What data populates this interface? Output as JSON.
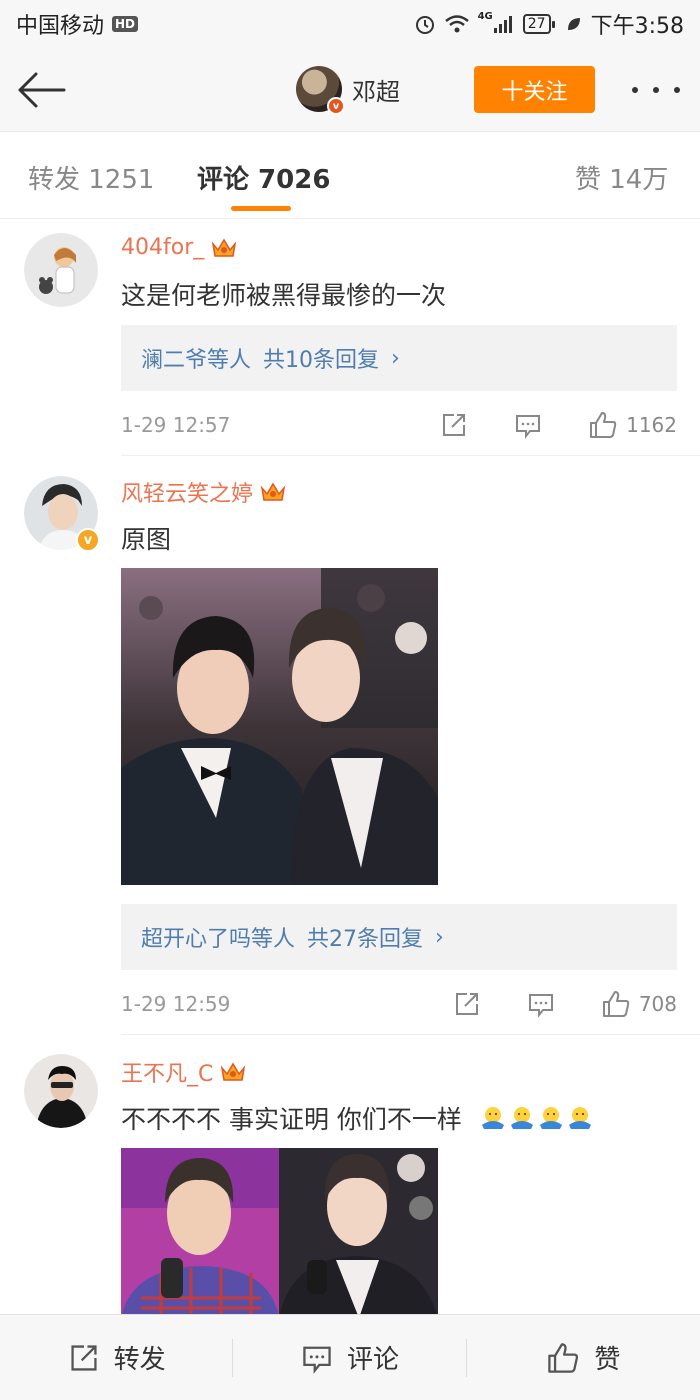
{
  "status_bar": {
    "carrier": "中国移动",
    "hd": "HD",
    "network": "4G",
    "battery": "27",
    "time": "下午3:58"
  },
  "header": {
    "user_name": "邓超",
    "follow_label": "十关注"
  },
  "tabs": {
    "repost": "转发 1251",
    "comments": "评论 7026",
    "likes": "赞 14万"
  },
  "comments": [
    {
      "username": "404for_",
      "text": "这是何老师被黑得最惨的一次",
      "reply_users": "澜二爷等人",
      "reply_count": "共10条回复",
      "time": "1-29 12:57",
      "likes": "1162"
    },
    {
      "username": "风轻云笑之婷",
      "text": "原图",
      "reply_users": "超开心了吗等人",
      "reply_count": "共27条回复",
      "time": "1-29 12:59",
      "likes": "708"
    },
    {
      "username": "王不凡_C",
      "text": "不不不不 事实证明 你们不一样"
    }
  ],
  "bottom_bar": {
    "repost": "转发",
    "comment": "评论",
    "like": "赞"
  },
  "colors": {
    "accent": "#ff8200",
    "username": "#eb7350",
    "link": "#507daf"
  }
}
